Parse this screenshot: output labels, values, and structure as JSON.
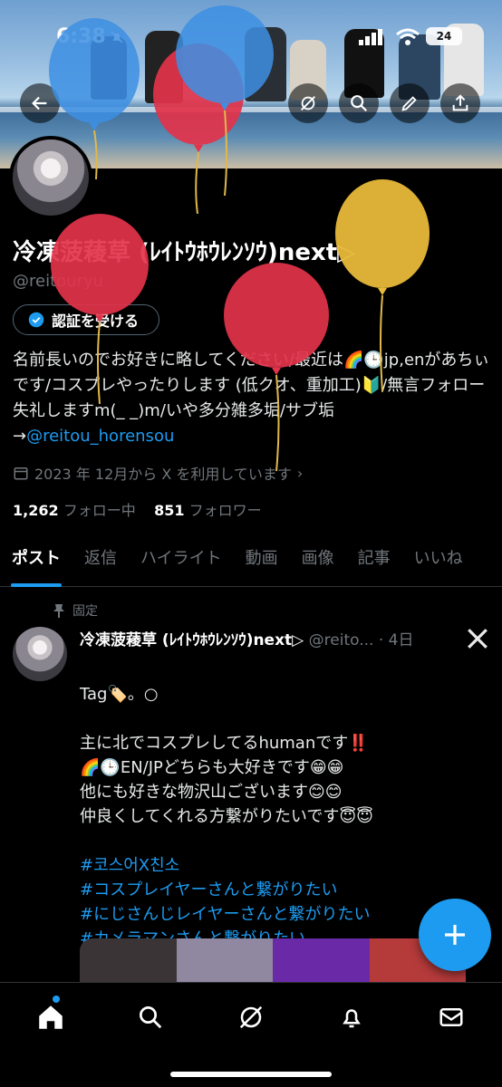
{
  "status_bar": {
    "time": "6:38",
    "battery": "24"
  },
  "profile": {
    "display_name": "冷凍菠薐草 (ﾚｲﾄｳﾎｳﾚﾝｿｳ)next▷",
    "handle": "@reitouryu",
    "verify_button": "認証を受ける",
    "bio_text": "名前長いのでお好きに略してください/最近は🌈🕒jp,enがあちぃです/コスプレやったりします (低クオ、重加工)🔰/無言フォロー失礼しますm(_ _)m/いや多分雑多垢/サブ垢→",
    "bio_link": "@reitou_horensou",
    "joined": "2023 年 12月から X を利用しています",
    "following_count": "1,262",
    "following_label": "フォロー中",
    "followers_count": "851",
    "followers_label": "フォロワー"
  },
  "tabs": [
    "ポスト",
    "返信",
    "ハイライト",
    "動画",
    "画像",
    "記事",
    "いいね"
  ],
  "tweet": {
    "pinned_label": "固定",
    "author_name": "冷凍菠薐草 (ﾚｲﾄｳﾎｳﾚﾝｿｳ)next▷",
    "author_handle": "@reito...",
    "time_ago": "· 4日",
    "body_intro": "Tag🏷️。○\n\n主に北でコスプレしてるhumanです‼️\n🌈🕒EN/JPどちらも大好きです😁😁\n他にも好きな物沢山ございます😊😊\n仲良くしてくれる方繋がりたいです😇😇\n",
    "hashtags": [
      "#코스어X친소",
      "#コスプレイヤーさんと繋がりたい",
      "#にじさんじレイヤーさんと繋がりたい",
      "#カメラマンさんと繋がりたい"
    ]
  },
  "colors": {
    "accent": "#1d9bf0",
    "balloon_red": "#e2334a",
    "balloon_blue": "#3d8fe3",
    "balloon_gold": "#e8b93a"
  },
  "icons": [
    "back-arrow-icon",
    "grok-icon",
    "search-icon",
    "edit-icon",
    "share-icon",
    "verified-badge-icon",
    "calendar-icon",
    "pin-icon",
    "x-logo-icon",
    "plus-icon",
    "home-icon",
    "search-icon",
    "grok-icon",
    "bell-icon",
    "mail-icon"
  ]
}
